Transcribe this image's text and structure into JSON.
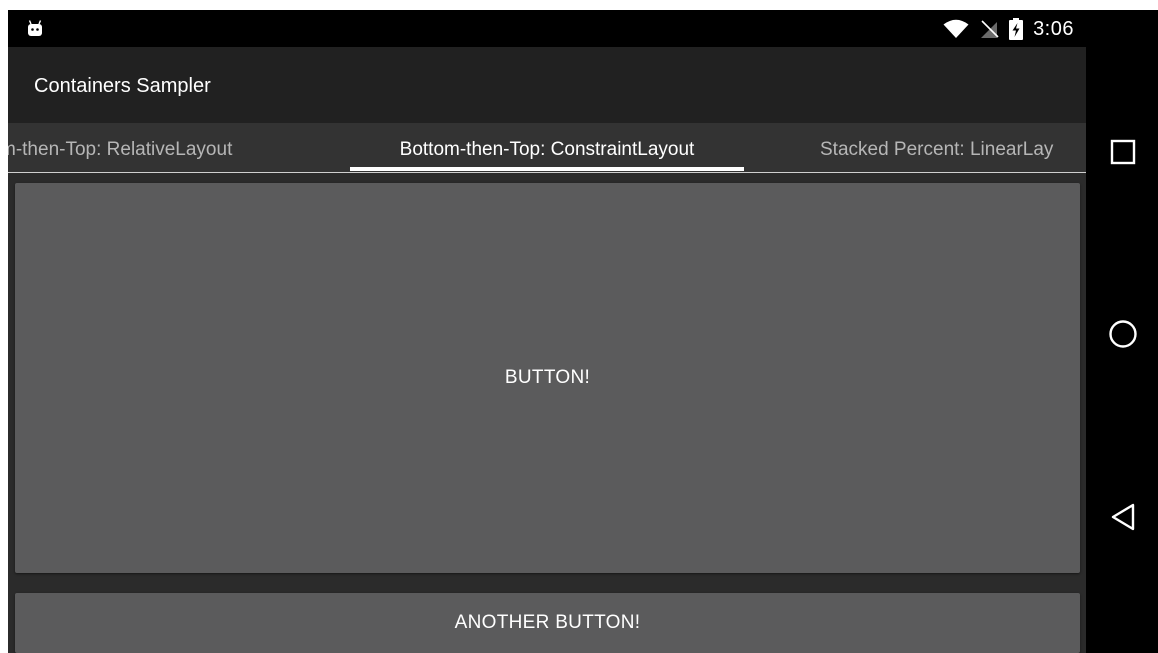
{
  "status_bar": {
    "time": "3:06",
    "icons": [
      "android-icon",
      "wifi-icon",
      "no-sim-icon",
      "battery-charging-icon"
    ]
  },
  "app_bar": {
    "title": "Containers Sampler"
  },
  "tabs": [
    {
      "label": "m-then-Top: RelativeLayout",
      "active": false
    },
    {
      "label": "Bottom-then-Top: ConstraintLayout",
      "active": true
    },
    {
      "label": "Stacked Percent: LinearLay",
      "active": false
    }
  ],
  "content": {
    "main_button_label": "BUTTON!",
    "another_button_label": "ANOTHER BUTTON!"
  },
  "nav_bar": {
    "icons": [
      "recents-icon",
      "home-icon",
      "back-icon"
    ]
  },
  "colors": {
    "status_bar": "#000000",
    "app_bar": "#212121",
    "tab_strip": "#333333",
    "content_bg": "#2b2b2b",
    "button": "#5b5b5c",
    "tab_indicator": "#ffffff"
  }
}
